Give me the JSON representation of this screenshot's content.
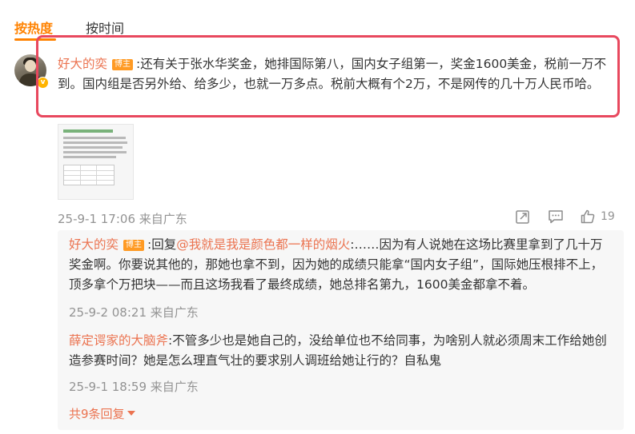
{
  "tabs": {
    "hot": "按热度",
    "time": "按时间"
  },
  "main_comment": {
    "username": "好大的奕",
    "tag": "博主",
    "text": ":还有关于张水华奖金，她排国际第八，国内女子组第一，奖金1600美金，税前一万不到。国内组是否另外给、给多少，也就一万多点。税前大概有个2万，不是网传的几十万人民币哈。",
    "datetime": "25-9-1 17:06 来自广东",
    "like_count": "19"
  },
  "replies": [
    {
      "username": "好大的奕",
      "tag": "博主",
      "prefix": ":回复",
      "mention": "@我就是我是颜色都一样的烟火",
      "text": ":……因为有人说她在这场比赛里拿到了几十万奖金啊。你要说其他的，那她也拿不到，因为她的成绩只能拿“国内女子组”，国际她压根排不上，顶多拿个万把块——而且这场我看了最终成绩，她总排名第九，1600美金都拿不着。",
      "datetime": "25-9-2 08:21 来自广东"
    },
    {
      "username": "薛定谔家的大脑斧",
      "text": ":不管多少也是她自己的，没给单位也不给同事，为啥别人就必须周末工作给她创造参赛时间？她是怎么理直气壮的要求别人调班给她让行的？自私鬼",
      "datetime": "25-9-1 18:59 来自广东"
    }
  ],
  "more_replies": "共9条回复",
  "colors": {
    "accent": "#ff8200",
    "username": "#eb7350",
    "highlight": "#e8485e",
    "tag": "#ff9a23"
  },
  "icons": [
    "share-icon",
    "comment-icon",
    "like-icon",
    "chevron-down-icon",
    "verified-icon"
  ]
}
